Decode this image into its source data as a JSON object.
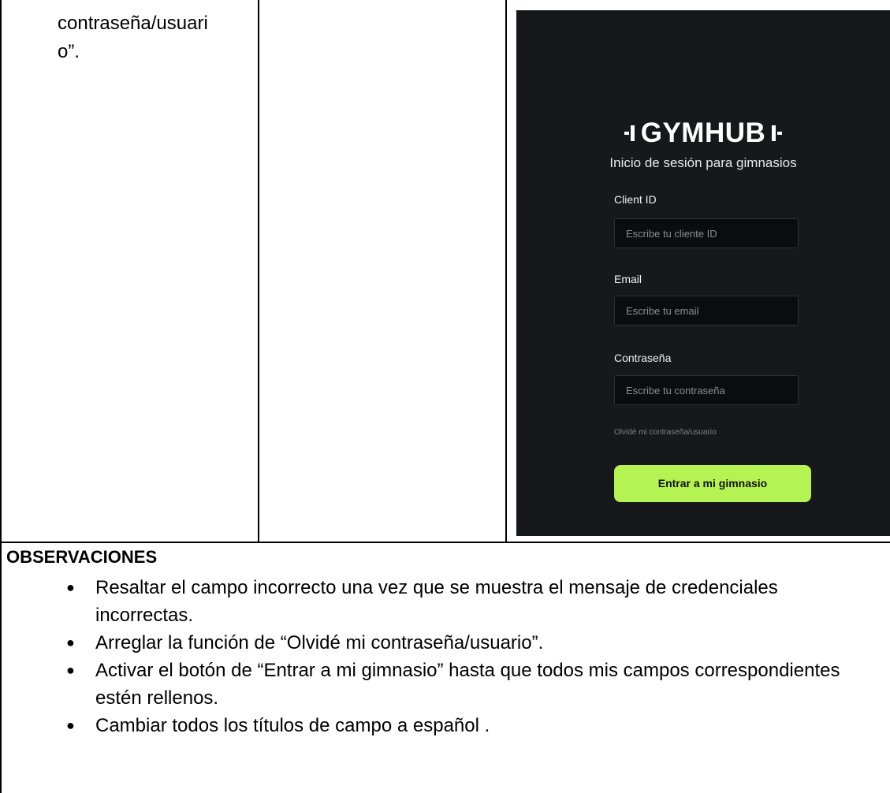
{
  "table": {
    "cell1_text": "contraseña/usuari\no”."
  },
  "login": {
    "logo": "GYMHUB",
    "subtitle": "Inicio de sesión para gimnasios",
    "fields": [
      {
        "label": "Client ID",
        "placeholder": "Escribe tu cliente ID"
      },
      {
        "label": "Email",
        "placeholder": "Escribe tu email"
      },
      {
        "label": "Contraseña",
        "placeholder": "Escribe tu contraseña"
      }
    ],
    "forgot": "Olvidé mi contraseña/usuario",
    "button": "Entrar a mi gimnasio",
    "colors": {
      "background": "#16181c",
      "accent": "#b5f352"
    }
  },
  "observations": {
    "title": "OBSERVACIONES",
    "items": [
      "Resaltar el campo incorrecto una vez que se muestra el mensaje de credenciales incorrectas.",
      "Arreglar la función de “Olvidé mi contraseña/usuario”.",
      "Activar el botón de “Entrar a mi gimnasio” hasta que todos mis campos correspondientes estén rellenos.",
      "Cambiar todos los títulos de campo a español ."
    ]
  }
}
